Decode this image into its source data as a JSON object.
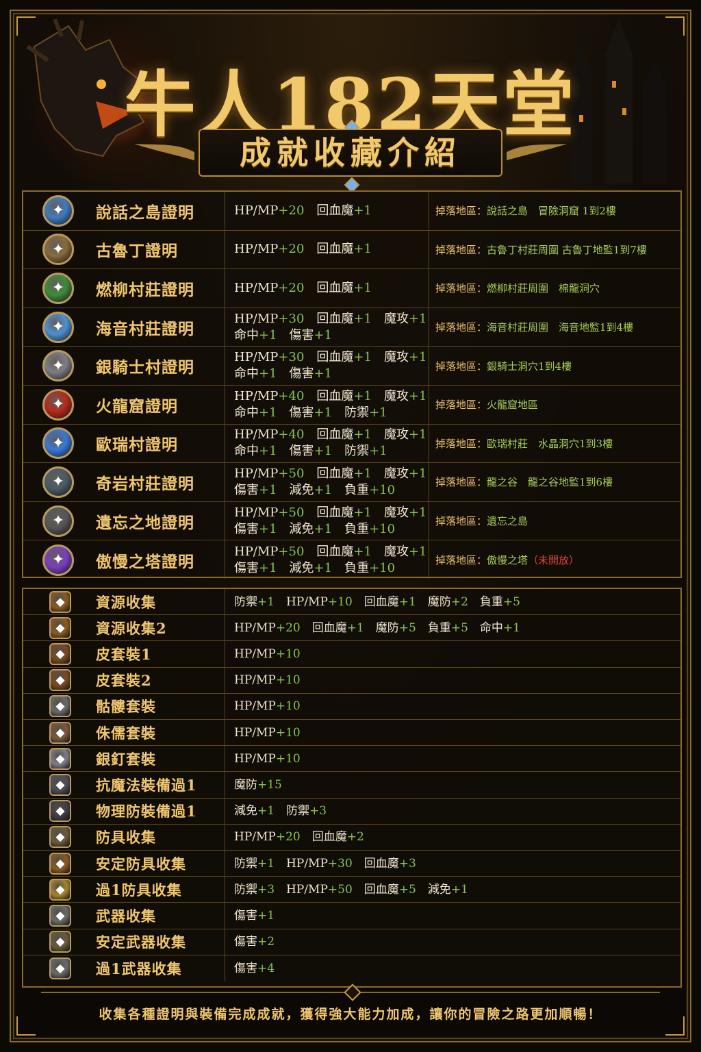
{
  "header": {
    "title": "牛人182天堂",
    "subtitle": "成就收藏介紹"
  },
  "proofs": [
    {
      "icon": "island-badge-icon",
      "color": "#3f7bbf",
      "name": "說話之島證明",
      "stat1": "HP/MP+20　回血魔+1",
      "stat2": "",
      "drop_label": "掉落地區：",
      "drop_loc": "說話之島　冒險洞窟 1到2樓",
      "drop_note": ""
    },
    {
      "icon": "shield-badge-icon",
      "color": "#8a6a3c",
      "name": "古魯丁證明",
      "stat1": "HP/MP+20　回血魔+1",
      "stat2": "",
      "drop_label": "掉落地區：",
      "drop_loc": "古魯丁村莊周圍 古魯丁地監1到7樓",
      "drop_note": ""
    },
    {
      "icon": "tree-badge-icon",
      "color": "#3f8a3c",
      "name": "燃柳村莊證明",
      "stat1": "HP/MP+20　回血魔+1",
      "stat2": "",
      "drop_label": "掉落地區：",
      "drop_loc": "燃柳村莊周圍　棉龍洞穴",
      "drop_note": ""
    },
    {
      "icon": "crystal-badge-icon",
      "color": "#4f8fd0",
      "name": "海音村莊證明",
      "stat1": "HP/MP+30　回血魔+1　魔攻+1",
      "stat2": "命中+1　傷害+1",
      "drop_label": "掉落地區：",
      "drop_loc": "海音村莊周圍　海音地監1到4樓",
      "drop_note": ""
    },
    {
      "icon": "knight-shield-icon",
      "color": "#7d7d86",
      "name": "銀騎士村證明",
      "stat1": "HP/MP+30　回血魔+1　魔攻+1",
      "stat2": "命中+1　傷害+1",
      "drop_label": "掉落地區：",
      "drop_loc": "銀騎士洞穴1到4樓",
      "drop_note": ""
    },
    {
      "icon": "fire-dragon-icon",
      "color": "#b52a1c",
      "name": "火龍窟證明",
      "stat1": "HP/MP+40　回血魔+1　魔攻+1",
      "stat2": "命中+1　傷害+1　防禦+1",
      "drop_label": "掉落地區：",
      "drop_loc": "火龍窟地區",
      "drop_note": ""
    },
    {
      "icon": "blue-crystal-icon",
      "color": "#3b78d8",
      "name": "歐瑞村證明",
      "stat1": "HP/MP+40　回血魔+1　魔攻+1",
      "stat2": "命中+1　傷害+1　防禦+1",
      "drop_label": "掉落地區：",
      "drop_loc": "歐瑞村莊　水晶洞穴1到3樓",
      "drop_note": ""
    },
    {
      "icon": "rock-helm-icon",
      "color": "#4b5b66",
      "name": "奇岩村莊證明",
      "stat1": "HP/MP+50　回血魔+1　魔攻+1",
      "stat2": "傷害+1　減免+1　負重+10",
      "drop_label": "掉落地區：",
      "drop_loc": "龍之谷　龍之谷地監1到6樓",
      "drop_note": ""
    },
    {
      "icon": "dark-helm-icon",
      "color": "#565656",
      "name": "遺忘之地證明",
      "stat1": "HP/MP+50　回血魔+1　魔攻+1",
      "stat2": "傷害+1　減免+1　負重+10",
      "drop_label": "掉落地區：",
      "drop_loc": "遺忘之島",
      "drop_note": ""
    },
    {
      "icon": "tower-badge-icon",
      "color": "#7a3fbf",
      "name": "傲慢之塔證明",
      "stat1": "HP/MP+50　回血魔+1　魔攻+1",
      "stat2": "傷害+1　減免+1　負重+10",
      "drop_label": "掉落地區：",
      "drop_loc": "傲慢之塔",
      "drop_note": "（未開放）"
    }
  ],
  "collections": [
    {
      "icon": "chest-icon",
      "color": "#8a5a22",
      "name": "資源收集",
      "stat": "防禦+1　HP/MP+10　回血魔+1　魔防+2　負重+5"
    },
    {
      "icon": "chest-icon",
      "color": "#8a5a22",
      "name": "資源收集2",
      "stat": "HP/MP+20　回血魔+1　魔防+5　負重+5　命中+1"
    },
    {
      "icon": "leather-armor-icon",
      "color": "#7a4a22",
      "name": "皮套裝1",
      "stat": "HP/MP+10"
    },
    {
      "icon": "leather-armor-icon",
      "color": "#7a4a22",
      "name": "皮套裝2",
      "stat": "HP/MP+10"
    },
    {
      "icon": "skull-icon",
      "color": "#6a6a6a",
      "name": "骷髏套裝",
      "stat": "HP/MP+10"
    },
    {
      "icon": "dwarf-helm-icon",
      "color": "#7a5a3a",
      "name": "侏儒套裝",
      "stat": "HP/MP+10"
    },
    {
      "icon": "silver-armor-icon",
      "color": "#7e7e86",
      "name": "銀釘套裝",
      "stat": "HP/MP+10"
    },
    {
      "icon": "magic-armor-icon",
      "color": "#4e4e56",
      "name": "抗魔法裝備過1",
      "stat": "魔防+15"
    },
    {
      "icon": "plate-armor-icon",
      "color": "#3e3e46",
      "name": "物理防裝備過1",
      "stat": "減免+1　防禦+3"
    },
    {
      "icon": "shield-icon",
      "color": "#6a5a3a",
      "name": "防具收集",
      "stat": "HP/MP+20　回血魔+2"
    },
    {
      "icon": "armor-icon",
      "color": "#8a5a22",
      "name": "安定防具收集",
      "stat": "防禦+1　HP/MP+30　回血魔+3"
    },
    {
      "icon": "gold-shield-icon",
      "color": "#a8842e",
      "name": "過1防具收集",
      "stat": "防禦+3　HP/MP+50　回血魔+5　減免+1"
    },
    {
      "icon": "crossed-swords-icon",
      "color": "#6a6a6a",
      "name": "武器收集",
      "stat": "傷害+1"
    },
    {
      "icon": "skull-swords-icon",
      "color": "#6a5a3a",
      "name": "安定武器收集",
      "stat": "傷害+2"
    },
    {
      "icon": "crossed-swords-icon",
      "color": "#6a6a6a",
      "name": "過1武器收集",
      "stat": "傷害+4"
    }
  ],
  "footer": "收集各種證明與裝備完成成就，獲得強大能力加成，讓你的冒險之路更加順暢！"
}
